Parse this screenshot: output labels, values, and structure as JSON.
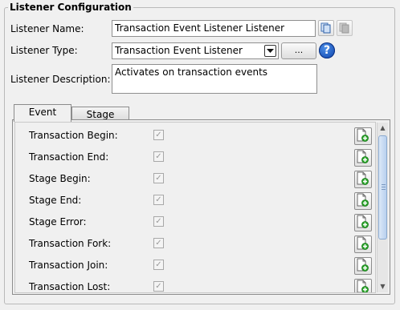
{
  "group": {
    "title": "Listener Configuration"
  },
  "form": {
    "name_label": "Listener Name:",
    "name_value": "Transaction Event Listener Listener",
    "type_label": "Listener Type:",
    "type_value": "Transaction Event Listener",
    "browse_label": "...",
    "help_label": "?",
    "description_label": "Listener Description:",
    "description_value": "Activates on transaction events"
  },
  "tabs": [
    {
      "label": "Event",
      "active": true
    },
    {
      "label": "Stage",
      "active": false
    }
  ],
  "events": [
    {
      "label": "Transaction Begin:",
      "checked": true
    },
    {
      "label": "Transaction End:",
      "checked": true
    },
    {
      "label": "Stage Begin:",
      "checked": true
    },
    {
      "label": "Stage End:",
      "checked": true
    },
    {
      "label": "Stage Error:",
      "checked": true
    },
    {
      "label": "Transaction Fork:",
      "checked": true
    },
    {
      "label": "Transaction Join:",
      "checked": true
    },
    {
      "label": "Transaction Lost:",
      "checked": true
    }
  ],
  "icons": {
    "copy": "copy-icon",
    "paste": "paste-icon",
    "dropdown": "chevron-down-icon",
    "help": "help-icon",
    "row_action": "add-document-icon"
  },
  "colors": {
    "background": "#f0f0f0",
    "help_blue": "#0a3fa8",
    "add_green": "#2aa52a"
  }
}
